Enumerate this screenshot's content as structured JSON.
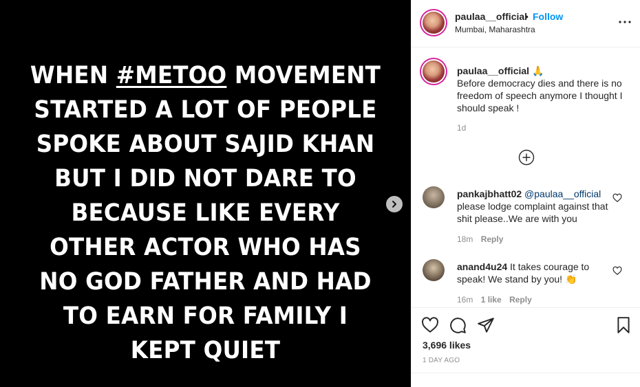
{
  "media": {
    "hashtag": "#METOO",
    "lines": [
      "MOVEMENT",
      "STARTED A LOT OF PEOPLE",
      "SPOKE ABOUT SAJID KHAN",
      "BUT I DID NOT DARE TO",
      "BECAUSE LIKE EVERY",
      "OTHER ACTOR WHO HAS",
      "NO GOD FATHER AND HAD",
      "TO EARN FOR FAMILY I",
      "KEPT QUIET"
    ],
    "first_word": "WHEN",
    "next_icon": "chevron-right-icon"
  },
  "header": {
    "username": "paulaa__official",
    "dot": "•",
    "follow_label": "Follow",
    "location": "Mumbai, Maharashtra",
    "more_icon": "more-horizontal-icon"
  },
  "caption": {
    "username": "paulaa__official",
    "emoji": "🙏",
    "text": "Before democracy dies and there is no freedom of speech anymore I thought I should speak !",
    "time": "1d"
  },
  "comments": [
    {
      "username": "pankajbhatt02",
      "mention": "@paulaa__official",
      "text": "please lodge complaint against that shit please..We are with you",
      "time": "18m",
      "reply": "Reply"
    },
    {
      "username": "anand4u24",
      "text": "It takes courage to speak! We stand by you!",
      "emoji": "👏",
      "time": "16m",
      "likes": "1 like",
      "reply": "Reply"
    }
  ],
  "actions": {
    "likes": "3,696 likes",
    "date": "1 DAY AGO"
  },
  "colors": {
    "follow": "#0095f6",
    "ring": "#d6249f"
  }
}
